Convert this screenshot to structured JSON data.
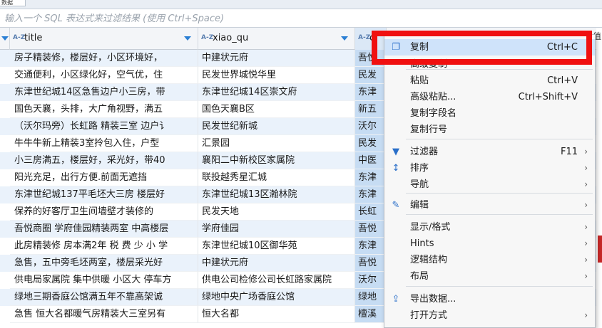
{
  "top_tab": "数据",
  "filter": {
    "placeholder": "输入一个 SQL 表达式来过滤结果 (使用 Ctrl+Space)"
  },
  "columns": [
    {
      "name": "title"
    },
    {
      "name": "xiao_qu"
    },
    {
      "name": "c"
    }
  ],
  "right_edge_label": "值",
  "rows": [
    {
      "title": "房子精装修，楼层好，小区环境好，",
      "xiao_qu": "中建状元府",
      "sel": "吾悦"
    },
    {
      "title": "交通便利，小区绿化好，空气优，住",
      "xiao_qu": "民发世界城悦华里",
      "sel": "民发"
    },
    {
      "title": "东津世纪城14区急售边户小三房，带",
      "xiao_qu": "东津世纪城14区崇文府",
      "sel": "东津"
    },
    {
      "title": "国色天襄，头排，大广角视野，满五",
      "xiao_qu": "国色天襄B区",
      "sel": "新五"
    },
    {
      "title": "（沃尔玛旁）长虹路 精装三室 边户讠",
      "xiao_qu": "民发世纪新城",
      "sel": "沃尔"
    },
    {
      "title": "牛牛牛新上精装3室拎包入住，户型",
      "xiao_qu": "汇景园",
      "sel": "民发"
    },
    {
      "title": "小三房满五，楼层好，采光好，带40",
      "xiao_qu": "襄阳二中新校区家属院",
      "sel": "中医"
    },
    {
      "title": "阳光充足，出行方便.前面无遮挡",
      "xiao_qu": "联投越秀星汇城",
      "sel": "东津"
    },
    {
      "title": "东津世纪城137平毛坯大三房 楼层好",
      "xiao_qu": "东津世纪城13区瀚林院",
      "sel": "东津"
    },
    {
      "title": "保养的好客厅卫生间墙壁才装修的",
      "xiao_qu": "民发天地",
      "sel": "长虹"
    },
    {
      "title": "吾悦商圈 学府佳园精装两室 中高楼层",
      "xiao_qu": "学府佳园",
      "sel": "吾悦"
    },
    {
      "title": "此房精装修 房本满2年 税 费 少 小 学",
      "xiao_qu": "东津世纪城10区御华苑",
      "sel": "东津"
    },
    {
      "title": "急售，五中旁毛坯两室，楼层采光好",
      "xiao_qu": "中建状元府",
      "sel": "吾悦"
    },
    {
      "title": "供电局家属院 集中供暖 小区大 停车方",
      "xiao_qu": "供电公司检修公司长虹路家属院",
      "sel": "沃尔"
    },
    {
      "title": "绿地三期香庭公馆满五年不靠高架诚",
      "xiao_qu": "绿地中央广场香庭公馆",
      "sel": "绿地"
    },
    {
      "title": "急售 恒大名都暖气房精装大三室另有",
      "xiao_qu": "恒大名都",
      "sel": "檀溪"
    }
  ],
  "context_menu": {
    "items": [
      {
        "icon": "copy-icon",
        "label": "复制",
        "shortcut": "Ctrl+C",
        "highlighted": true
      },
      {
        "icon": "",
        "label": "高级复制",
        "shortcut": ""
      },
      {
        "icon": "",
        "label": "粘贴",
        "shortcut": "Ctrl+V"
      },
      {
        "icon": "",
        "label": "高级粘贴...",
        "shortcut": "Ctrl+Shift+V"
      },
      {
        "icon": "",
        "label": "复制字段名",
        "shortcut": ""
      },
      {
        "icon": "",
        "label": "复制行号",
        "shortcut": ""
      },
      {
        "icon": "filter-icon",
        "label": "过滤器",
        "shortcut": "F11",
        "submenu": true
      },
      {
        "icon": "sort-icon",
        "label": "排序",
        "shortcut": "",
        "submenu": true
      },
      {
        "icon": "",
        "label": "导航",
        "shortcut": "",
        "submenu": true
      },
      {
        "icon": "edit-icon",
        "label": "编辑",
        "shortcut": "",
        "submenu": true
      },
      {
        "icon": "",
        "label": "显示/格式",
        "shortcut": "",
        "submenu": true
      },
      {
        "icon": "",
        "label": "Hints",
        "shortcut": "",
        "submenu": true
      },
      {
        "icon": "",
        "label": "逻辑结构",
        "shortcut": "",
        "submenu": true
      },
      {
        "icon": "",
        "label": "布局",
        "shortcut": "",
        "submenu": true
      },
      {
        "icon": "export-icon",
        "label": "导出数据...",
        "shortcut": ""
      },
      {
        "icon": "",
        "label": "打开方式",
        "shortcut": "",
        "submenu": true
      }
    ],
    "submenu_glyph": "›"
  },
  "colors": {
    "highlight_box": "#f01010",
    "selected_column": "#c6dcf3",
    "menu_hover": "#cfe3fa",
    "accent": "#2a7fd4"
  }
}
